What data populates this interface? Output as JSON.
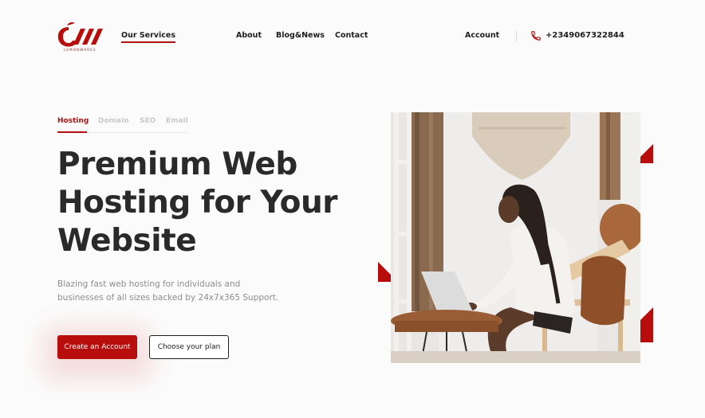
{
  "brand": {
    "logo_tagline": "LEMONWARES"
  },
  "nav": {
    "primary": [
      "Our Services",
      "About",
      "Blog&News",
      "Contact"
    ],
    "account": "Account",
    "phone": "+2349067322844"
  },
  "tabs": [
    "Hosting",
    "Domain",
    "SEO",
    "Email"
  ],
  "hero": {
    "title_lines": [
      "Premium Web",
      "Hosting for Your",
      "Website"
    ],
    "description_lines": [
      "Blazing fast web hosting for individuals and",
      "businesses of all sizes backed by 24x7x365 Support."
    ],
    "cta_primary": "Create an Account",
    "cta_secondary": "Choose your plan"
  },
  "colors": {
    "accent": "#b80d0d",
    "text": "#2a2a2a",
    "muted": "#8d8d8d",
    "tab_inactive": "#c9c9c9"
  },
  "icons": {
    "phone": "phone-icon",
    "logo": "lemonwares-logo-icon"
  }
}
